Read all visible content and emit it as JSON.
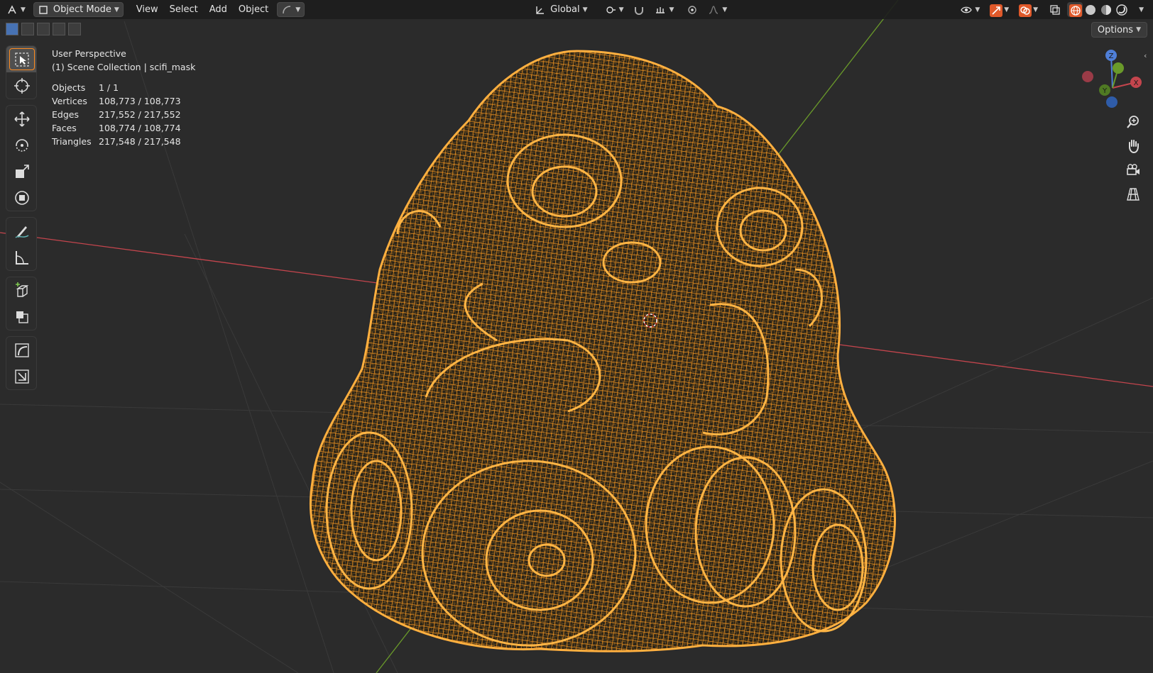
{
  "header": {
    "mode": "Object Mode",
    "menus": [
      "View",
      "Select",
      "Add",
      "Object"
    ],
    "orientation": "Global"
  },
  "row2": {
    "options_label": "Options"
  },
  "overlay": {
    "view_name": "User Perspective",
    "collection": "(1) Scene Collection | scifi_mask",
    "stats": [
      {
        "label": "Objects",
        "value": "1 / 1"
      },
      {
        "label": "Vertices",
        "value": "108,773 / 108,773"
      },
      {
        "label": "Edges",
        "value": "217,552 / 217,552"
      },
      {
        "label": "Faces",
        "value": "108,774 / 108,774"
      },
      {
        "label": "Triangles",
        "value": "217,548 / 217,548"
      }
    ]
  },
  "gizmo": {
    "x": "X",
    "y": "Y",
    "z": "Z"
  },
  "icons": {
    "toolbar": [
      "select-box-icon",
      "cursor-icon",
      "move-icon",
      "rotate-icon",
      "scale-icon",
      "transform-icon",
      "annotate-icon",
      "measure-icon",
      "add-cube-icon",
      "duplicate-icon",
      "bend-icon",
      "shear-icon"
    ],
    "nav": [
      "zoom-icon",
      "pan-hand-icon",
      "camera-icon",
      "grid-view-icon"
    ]
  },
  "colors": {
    "wire": "#ff9a1f",
    "x_axis": "#c4454d",
    "y_axis": "#6a9a2a",
    "active_tool": "#ff8b1f",
    "accent": "#4772b3"
  }
}
